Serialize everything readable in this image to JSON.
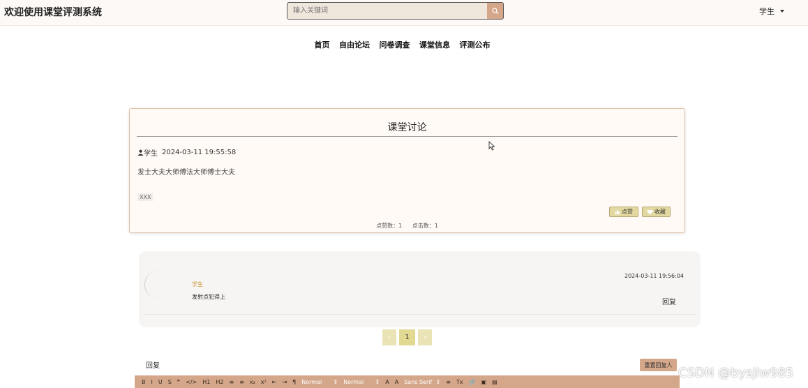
{
  "header": {
    "site_title": "欢迎使用课堂评测系统",
    "search_placeholder": "输入关键词",
    "user_label": "学生"
  },
  "nav": {
    "items": [
      "首页",
      "自由论坛",
      "问卷调查",
      "课堂信息",
      "评测公布"
    ]
  },
  "post": {
    "title": "课堂讨论",
    "author": "学生",
    "date": "2024-03-11 19:55:58",
    "content": "发士大夫大师傅法大师傅士大夫",
    "tag": "XXX",
    "like_label": "点赞",
    "favorite_label": "收藏",
    "likes_text": "点赞数：1",
    "clicks_text": "点击数：1"
  },
  "reply": {
    "user": "学生",
    "text": "发射点犯得上",
    "date": "2024-03-11 19:56:04",
    "action_label": "回复"
  },
  "pagination": {
    "prev": "‹",
    "current": "1",
    "next": "›"
  },
  "reply_form": {
    "label": "回复",
    "reset_label": "重置回复人"
  },
  "editor_toolbar": {
    "buttons": [
      "B",
      "I",
      "U",
      "S",
      "❞",
      "</>",
      "H1",
      "H2",
      "≡",
      "≡",
      "x₂",
      "x²",
      "⇤",
      "⇥",
      "¶"
    ],
    "header_select": "Normal",
    "size_select": "Normal",
    "font_select": "Sans Serif",
    "extra": [
      "A",
      "A",
      "≡",
      "Tx",
      "🔗",
      "▣",
      "▤"
    ]
  },
  "watermark": "CSDN @bysjlw985",
  "colors": {
    "accent": "#d4a78a",
    "card_border": "#e0c3a8",
    "button_bg": "#e3d9a0",
    "reply_user": "#c9952f"
  }
}
